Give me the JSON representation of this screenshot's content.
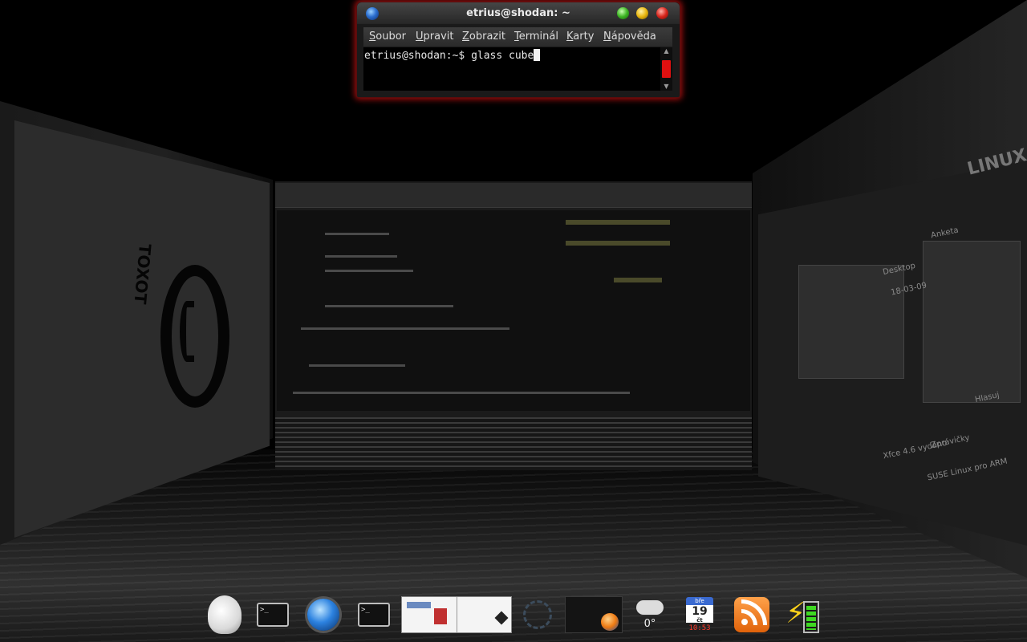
{
  "terminal": {
    "title": "etrius@shodan: ~",
    "menu": [
      {
        "underline": "S",
        "rest": "oubor"
      },
      {
        "underline": "U",
        "rest": "pravit"
      },
      {
        "underline": "Z",
        "rest": "obrazit"
      },
      {
        "underline": "T",
        "rest": "erminál"
      },
      {
        "underline": "K",
        "rest": "arty"
      },
      {
        "underline": "N",
        "rest": "ápověda"
      }
    ],
    "prompt": "etrius@shodan:~$ ",
    "command": "glass cube",
    "scroll_up": "▲",
    "scroll_down": "▼"
  },
  "left_wall": {
    "logo_text": "TOXOT"
  },
  "right_wall": {
    "brand": "LINUX",
    "items": [
      "Anketa",
      "Desktop",
      "Zprávičky",
      "SUSE Linux pro ARM",
      "Xfce 4.6 vydáno",
      "Hlasuj",
      "18-03-09"
    ]
  },
  "dock": {
    "weather_temp": "0°",
    "calendar_month": "bře",
    "calendar_date": "19",
    "calendar_day": "čt",
    "clock": "10:53"
  },
  "colors": {
    "accent": "#e01010",
    "window_glow": "#dc1414",
    "background": "#000000"
  },
  "icons": [
    "gimp-icon",
    "terminal-icon",
    "globe-icon",
    "terminal-icon",
    "window-thumbnails",
    "ring-icon",
    "firefox-icon",
    "weather-icon",
    "calendar-icon",
    "rss-icon",
    "battery-icon"
  ]
}
